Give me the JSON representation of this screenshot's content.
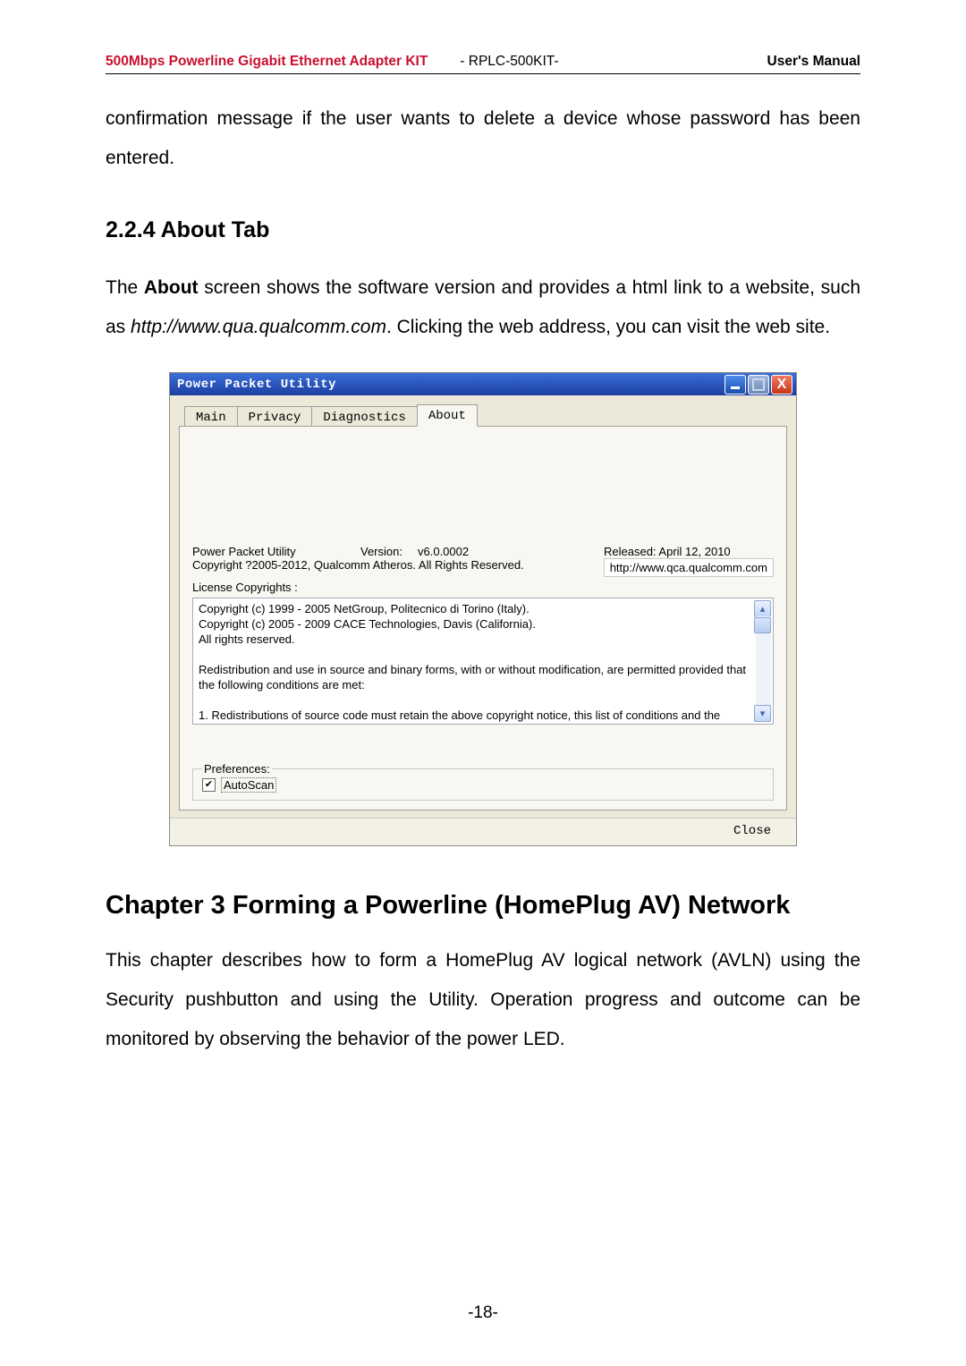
{
  "header": {
    "left": "500Mbps Powerline Gigabit Ethernet Adapter KIT",
    "mid": "- RPLC-500KIT-",
    "right": "User's Manual"
  },
  "para_top": "confirmation message if the user wants to delete a device whose password has been entered.",
  "h_224": "2.2.4 About Tab",
  "para_about_pre": "The ",
  "para_about_bold": "About",
  "para_about_mid": " screen shows the software version and provides a html link to a website, such as ",
  "para_about_url": "http://www.qua.qualcomm.com",
  "para_about_post": ". Clicking the web address, you can visit the web site.",
  "window": {
    "title": "Power Packet Utility",
    "tabs": {
      "main": "Main",
      "privacy": "Privacy",
      "diagnostics": "Diagnostics",
      "about": "About"
    },
    "app_name": "Power Packet Utility",
    "version_label": "Version:",
    "version_value": "v6.0.0002",
    "released": "Released: April 12, 2010",
    "copyright_main": "Copyright ?2005-2012, Qualcomm Atheros. All Rights Reserved.",
    "url": "http://www.qca.qualcomm.com",
    "license_label": "License Copyrights :",
    "license_text": "Copyright (c) 1999 - 2005 NetGroup, Politecnico di Torino (Italy).\nCopyright (c) 2005 - 2009 CACE Technologies, Davis (California).\nAll rights reserved.\n\nRedistribution and use in source and binary forms, with or without modification, are permitted provided that the following conditions are met:\n\n1. Redistributions of source code must retain the above copyright notice, this list of conditions and the following disclaimer.",
    "preferences_legend": "Preferences:",
    "autoscan": "AutoScan",
    "close": "Close"
  },
  "h_chapter": "Chapter 3 Forming a Powerline (HomePlug AV) Network",
  "para_ch3": "This chapter describes how to form a HomePlug AV logical network (AVLN) using the Security pushbutton and using the Utility. Operation progress and outcome can be monitored by observing the behavior of the power LED.",
  "page_number": "-18-"
}
